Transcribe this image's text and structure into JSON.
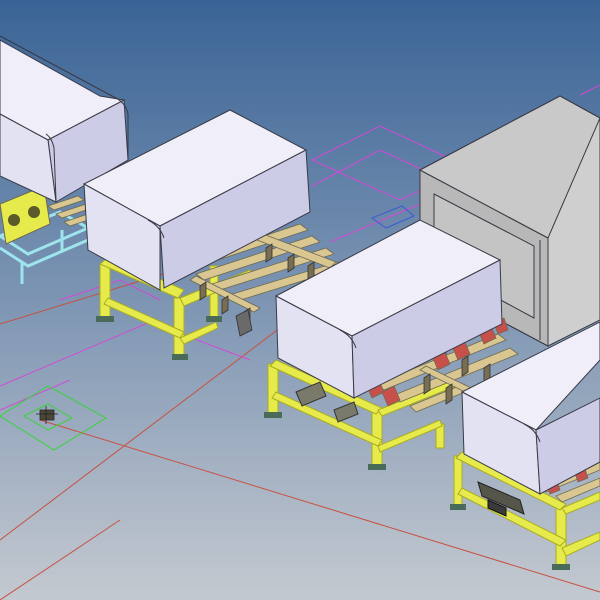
{
  "viewport": {
    "background": {
      "top": "#3a6496",
      "middle": "#7d95b3",
      "bottom": "#c4c9d0"
    }
  },
  "colors": {
    "box_face": "#e3e2f2",
    "box_side": "#cdcce6",
    "box_top": "#efeef9",
    "box_edge": "#3a3a46",
    "frame_yellow": "#e6ea4a",
    "frame_yellow_dark": "#a8ac22",
    "roller_wood": "#d9c690",
    "roller_dark": "#6e6a52",
    "cup_red": "#c8504a",
    "cyan_frame": "#9ee4ec",
    "machine_face": "#cfcfcf",
    "machine_side": "#b8b8b8",
    "magenta_line": "#d24ad6",
    "red_line": "#c85040",
    "green_line": "#3ad23a",
    "blue_line": "#3a5ad6"
  },
  "icons": [
    "coordinate-origin-marker-icon"
  ]
}
